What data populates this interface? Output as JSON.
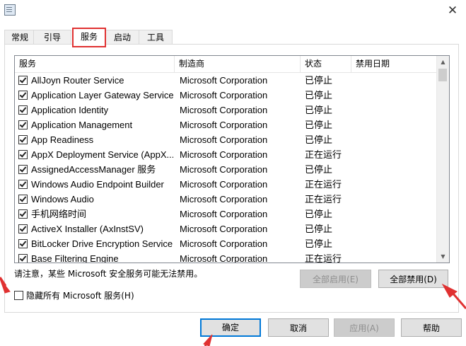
{
  "window": {
    "close_glyph": "✕"
  },
  "tabs": [
    {
      "label": "常规"
    },
    {
      "label": "引导"
    },
    {
      "label": "服务",
      "active": true
    },
    {
      "label": "启动"
    },
    {
      "label": "工具"
    }
  ],
  "services": {
    "columns": {
      "name": "服务",
      "manufacturer": "制造商",
      "status": "状态",
      "disabled_date": "禁用日期"
    },
    "rows": [
      {
        "name": "AllJoyn Router Service",
        "manufacturer": "Microsoft Corporation",
        "status": "已停止",
        "checked": true
      },
      {
        "name": "Application Layer Gateway Service",
        "manufacturer": "Microsoft Corporation",
        "status": "已停止",
        "checked": true
      },
      {
        "name": "Application Identity",
        "manufacturer": "Microsoft Corporation",
        "status": "已停止",
        "checked": true
      },
      {
        "name": "Application Management",
        "manufacturer": "Microsoft Corporation",
        "status": "已停止",
        "checked": true
      },
      {
        "name": "App Readiness",
        "manufacturer": "Microsoft Corporation",
        "status": "已停止",
        "checked": true
      },
      {
        "name": "AppX Deployment Service (AppX...",
        "manufacturer": "Microsoft Corporation",
        "status": "正在运行",
        "checked": true
      },
      {
        "name": "AssignedAccessManager 服务",
        "manufacturer": "Microsoft Corporation",
        "status": "已停止",
        "checked": true
      },
      {
        "name": "Windows Audio Endpoint Builder",
        "manufacturer": "Microsoft Corporation",
        "status": "正在运行",
        "checked": true
      },
      {
        "name": "Windows Audio",
        "manufacturer": "Microsoft Corporation",
        "status": "正在运行",
        "checked": true
      },
      {
        "name": "手机网络时间",
        "manufacturer": "Microsoft Corporation",
        "status": "已停止",
        "checked": true
      },
      {
        "name": "ActiveX Installer (AxInstSV)",
        "manufacturer": "Microsoft Corporation",
        "status": "已停止",
        "checked": true
      },
      {
        "name": "BitLocker Drive Encryption Service",
        "manufacturer": "Microsoft Corporation",
        "status": "已停止",
        "checked": true
      },
      {
        "name": "Base Filtering Engine",
        "manufacturer": "Microsoft Corporation",
        "status": "正在运行",
        "checked": true
      }
    ]
  },
  "note": "请注意，某些 Microsoft 安全服务可能无法禁用。",
  "enable_all": "全部启用(E)",
  "disable_all": "全部禁用(D)",
  "hide_ms_label": "隐藏所有 Microsoft 服务(H)",
  "hide_ms_checked": false,
  "footer": {
    "ok": "确定",
    "cancel": "取消",
    "apply": "应用(A)",
    "help": "帮助"
  },
  "colors": {
    "highlight": "#e03131",
    "focus": "#0078d7"
  }
}
